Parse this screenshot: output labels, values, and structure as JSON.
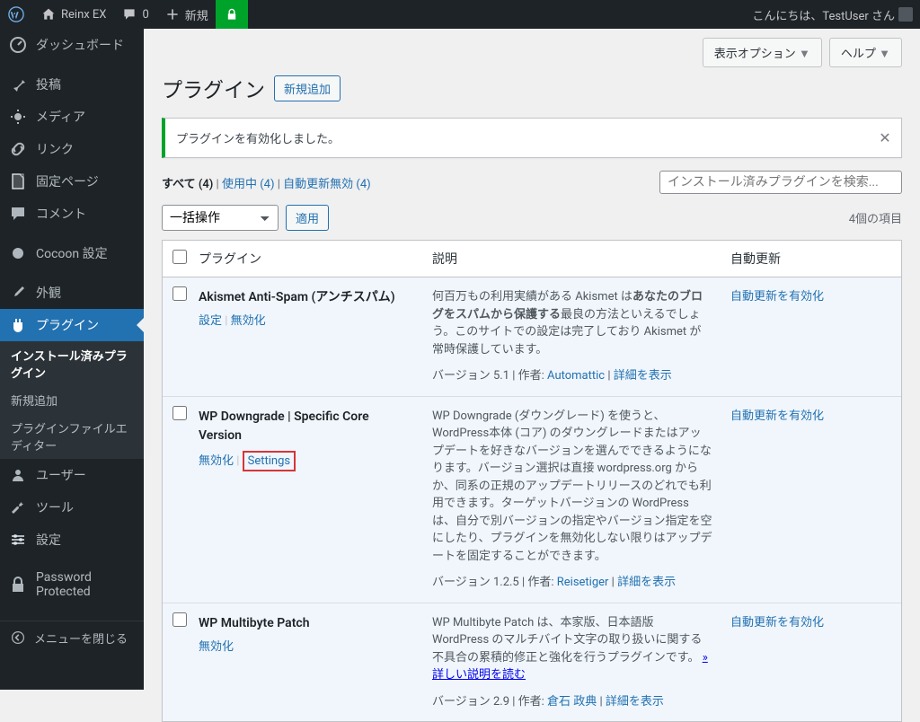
{
  "topbar": {
    "site": "Reinx EX",
    "comments": "0",
    "newlabel": "新規",
    "greeting": "こんにちは、TestUser さん"
  },
  "sidebar": {
    "items": [
      {
        "label": "ダッシュボード",
        "icon": "dash"
      },
      {
        "label": "投稿",
        "icon": "pin"
      },
      {
        "label": "メディア",
        "icon": "media"
      },
      {
        "label": "リンク",
        "icon": "link"
      },
      {
        "label": "固定ページ",
        "icon": "page"
      },
      {
        "label": "コメント",
        "icon": "comment"
      },
      {
        "label": "Cocoon 設定",
        "icon": "cocoon"
      },
      {
        "label": "外観",
        "icon": "appearance"
      },
      {
        "label": "プラグイン",
        "icon": "plugin"
      },
      {
        "label": "ユーザー",
        "icon": "users"
      },
      {
        "label": "ツール",
        "icon": "tools"
      },
      {
        "label": "設定",
        "icon": "settings"
      },
      {
        "label": "Password Protected",
        "icon": "lock"
      }
    ],
    "sub": [
      "インストール済みプラグイン",
      "新規追加",
      "プラグインファイルエディター"
    ],
    "collapse": "メニューを閉じる"
  },
  "header": {
    "screen_options": "表示オプション",
    "help": "ヘルプ",
    "title": "プラグイン",
    "addnew": "新規追加"
  },
  "notice": "プラグインを有効化しました。",
  "filters": {
    "all": "すべて",
    "all_count": "(4)",
    "active": "使用中",
    "active_count": "(4)",
    "autoupdate": "自動更新無効",
    "autoupdate_count": "(4)"
  },
  "search_placeholder": "インストール済みプラグインを検索...",
  "bulk": {
    "label": "一括操作",
    "apply": "適用"
  },
  "count_text": "4個の項目",
  "columns": {
    "plugin": "プラグイン",
    "desc": "説明",
    "auto": "自動更新"
  },
  "plugins": [
    {
      "name": "Akismet Anti-Spam (アンチスパム)",
      "actions_settings": "設定",
      "actions_deactivate": "無効化",
      "desc_pre": "何百万もの利用実績がある Akismet は",
      "desc_bold": "あなたのブログをスパムから保護する",
      "desc_post": "最良の方法といえるでしょう。このサイトでの設定は完了しており Akismet が常時保護しています。",
      "meta_version": "バージョン 5.1",
      "meta_authorlbl": "作者:",
      "meta_author": "Automattic",
      "meta_details": "詳細を表示",
      "auto": "自動更新を有効化"
    },
    {
      "name": "WP Downgrade | Specific Core Version",
      "actions_deactivate": "無効化",
      "actions_settings": "Settings",
      "desc": "WP Downgrade (ダウングレード) を使うと、WordPress本体 (コア) のダウングレードまたはアップデートを好きなバージョンを選んでできるようになります。バージョン選択は直接 wordpress.org からか、同系の正規のアップデートリリースのどれでも利用できます。ターゲットバージョンの WordPress は、自分で別バージョンの指定やバージョン指定を空にしたり、プラグインを無効化しない限りはアップデートを固定することができます。",
      "meta_version": "バージョン 1.2.5",
      "meta_authorlbl": "作者:",
      "meta_author": "Reisetiger",
      "meta_details": "詳細を表示",
      "auto": "自動更新を有効化"
    },
    {
      "name": "WP Multibyte Patch",
      "actions_deactivate": "無効化",
      "desc": "WP Multibyte Patch は、本家版、日本語版 WordPress のマルチバイト文字の取り扱いに関する不具合の累積的修正と強化を行うプラグインです。",
      "desc_link": "» 詳しい説明を読む",
      "meta_version": "バージョン 2.9",
      "meta_authorlbl": "作者:",
      "meta_author": "倉石 政典",
      "meta_details": "詳細を表示",
      "auto": "自動更新を有効化"
    }
  ]
}
